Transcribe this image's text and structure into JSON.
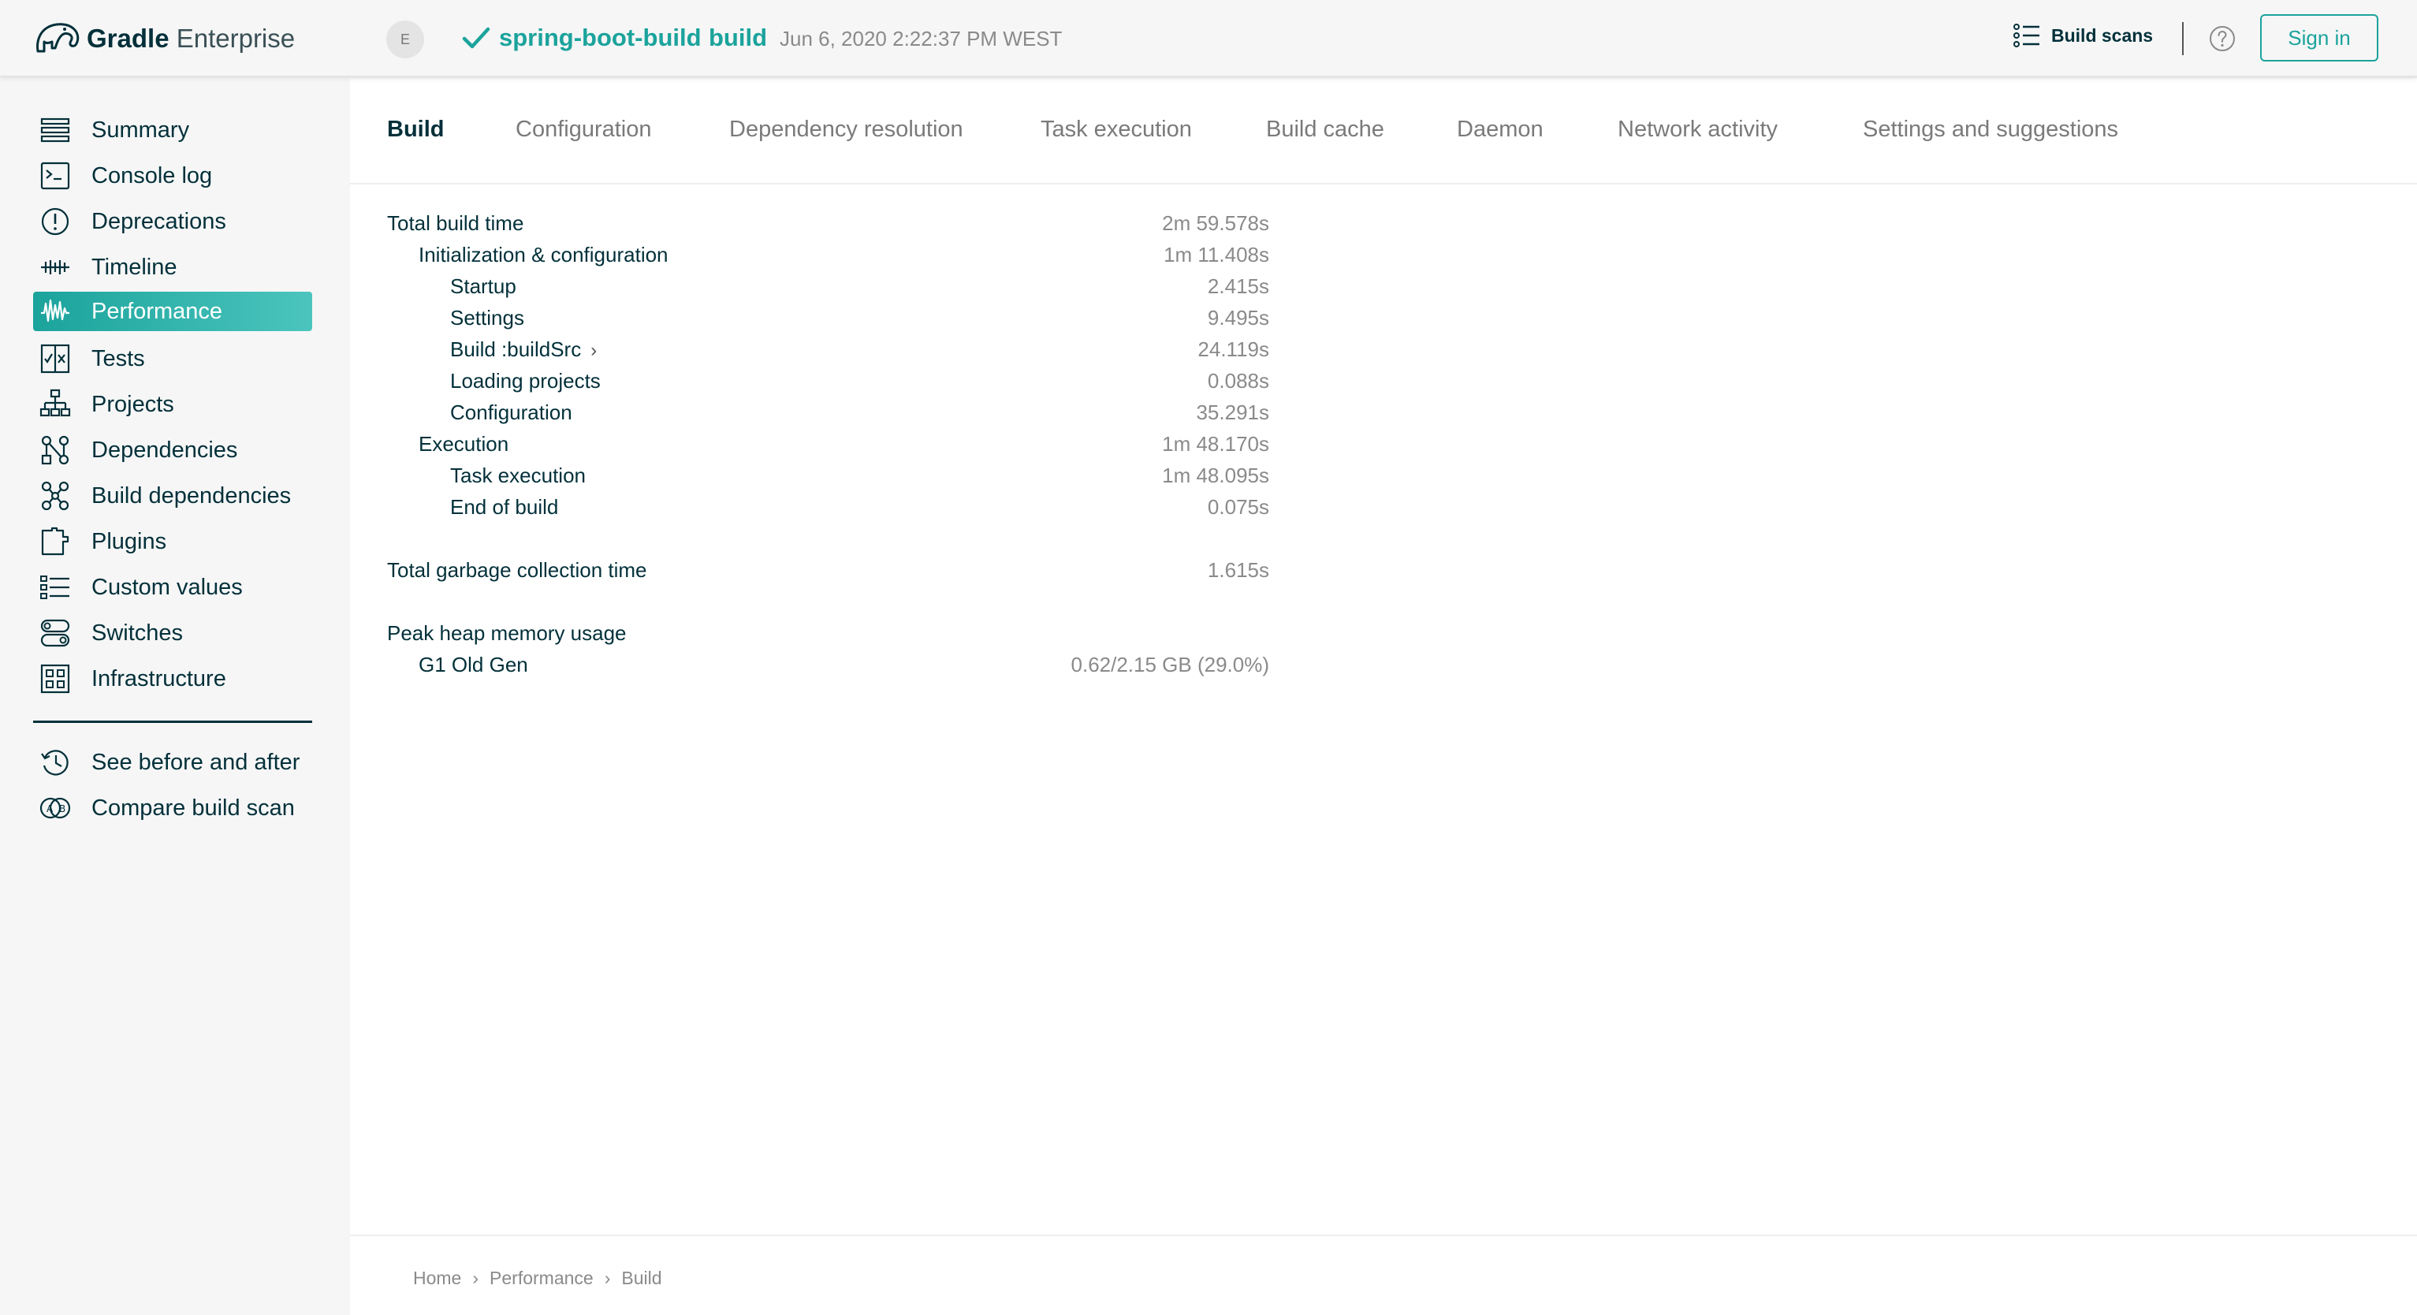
{
  "header": {
    "logo_brand": "Gradle",
    "logo_product": "Enterprise",
    "user_initial": "E",
    "project_name": "spring-boot-build",
    "task_name": "build",
    "build_date": "Jun 6, 2020 2:22:37 PM WEST",
    "build_scans_label": "Build scans",
    "sign_in_label": "Sign in",
    "status": "success",
    "accent_color": "#1ba39c"
  },
  "sidebar": {
    "items": [
      {
        "label": "Summary",
        "icon": "summary-icon"
      },
      {
        "label": "Console log",
        "icon": "console-icon"
      },
      {
        "label": "Deprecations",
        "icon": "deprecations-icon"
      },
      {
        "label": "Timeline",
        "icon": "timeline-icon"
      },
      {
        "label": "Performance",
        "icon": "performance-icon",
        "active": true
      },
      {
        "label": "Tests",
        "icon": "tests-icon"
      },
      {
        "label": "Projects",
        "icon": "projects-icon"
      },
      {
        "label": "Dependencies",
        "icon": "dependencies-icon"
      },
      {
        "label": "Build dependencies",
        "icon": "build-dependencies-icon"
      },
      {
        "label": "Plugins",
        "icon": "plugins-icon"
      },
      {
        "label": "Custom values",
        "icon": "custom-values-icon"
      },
      {
        "label": "Switches",
        "icon": "switches-icon"
      },
      {
        "label": "Infrastructure",
        "icon": "infrastructure-icon"
      }
    ],
    "secondary": [
      {
        "label": "See before and after",
        "icon": "history-icon"
      },
      {
        "label": "Compare build scan",
        "icon": "compare-icon"
      }
    ]
  },
  "tabs": [
    "Build",
    "Configuration",
    "Dependency resolution",
    "Task execution",
    "Build cache",
    "Daemon",
    "Network activity",
    "Settings and suggestions"
  ],
  "metrics": {
    "total_build_time": {
      "label": "Total build time",
      "value": "2m 59.578s"
    },
    "init_config": {
      "label": "Initialization & configuration",
      "value": "1m 11.408s"
    },
    "startup": {
      "label": "Startup",
      "value": "2.415s"
    },
    "settings": {
      "label": "Settings",
      "value": "9.495s"
    },
    "build_src": {
      "label": "Build :buildSrc",
      "value": "24.119s",
      "chevron": "›"
    },
    "loading_projects": {
      "label": "Loading projects",
      "value": "0.088s"
    },
    "configuration": {
      "label": "Configuration",
      "value": "35.291s"
    },
    "execution": {
      "label": "Execution",
      "value": "1m 48.170s"
    },
    "task_execution": {
      "label": "Task execution",
      "value": "1m 48.095s"
    },
    "end_of_build": {
      "label": "End of build",
      "value": "0.075s"
    },
    "gc_time": {
      "label": "Total garbage collection time",
      "value": "1.615s"
    },
    "peak_heap": {
      "label": "Peak heap memory usage"
    },
    "g1_old_gen": {
      "label": "G1 Old Gen",
      "value": "0.62/2.15 GB (29.0%)"
    }
  },
  "breadcrumb": {
    "home": "Home",
    "section": "Performance",
    "page": "Build",
    "separator": "›"
  }
}
